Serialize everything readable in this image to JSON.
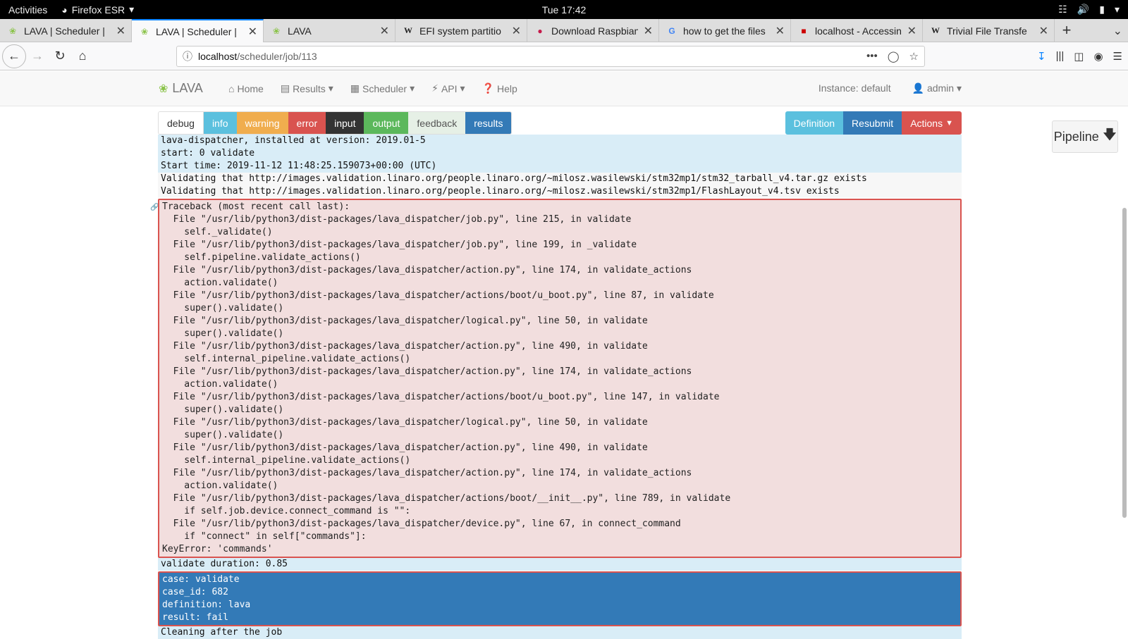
{
  "gnome": {
    "activities": "Activities",
    "app_name": "Firefox ESR",
    "clock": "Tue 17:42"
  },
  "tabs": [
    {
      "title": "LAVA | Scheduler |",
      "icon": "lava-leaf-icon"
    },
    {
      "title": "LAVA | Scheduler |",
      "icon": "lava-leaf-icon"
    },
    {
      "title": "LAVA",
      "icon": "lava-leaf-icon"
    },
    {
      "title": "EFI system partitio",
      "icon": "wikipedia-icon",
      "glyph": "W"
    },
    {
      "title": "Download Raspbian",
      "icon": "raspberry-icon"
    },
    {
      "title": "how to get the files",
      "icon": "google-icon",
      "glyph": "G"
    },
    {
      "title": "localhost - Accessin",
      "icon": "localhost-icon"
    },
    {
      "title": "Trivial File Transfe",
      "icon": "wikipedia-icon",
      "glyph": "W"
    }
  ],
  "url": {
    "host": "localhost",
    "path": "/scheduler/job/113"
  },
  "lava": {
    "brand": "LAVA",
    "menu": {
      "home": "Home",
      "results": "Results",
      "scheduler": "Scheduler",
      "api": "API",
      "help": "Help"
    },
    "instance": "Instance: default",
    "user": "admin"
  },
  "filters": {
    "debug": "debug",
    "info": "info",
    "warning": "warning",
    "error": "error",
    "input": "input",
    "output": "output",
    "feedback": "feedback",
    "results": "results"
  },
  "job_actions": {
    "definition": "Definition",
    "resubmit": "Resubmit",
    "actions": "Actions"
  },
  "pipeline": "Pipeline",
  "log": {
    "pre": [
      {
        "text": "lava-dispatcher, installed at version: 2019.01-5",
        "level": "info"
      },
      {
        "text": "start: 0 validate",
        "level": "info"
      },
      {
        "text": "Start time: 2019-11-12 11:48:25.159073+00:00 (UTC)",
        "level": "info"
      },
      {
        "text": "Validating that http://images.validation.linaro.org/people.linaro.org/~milosz.wasilewski/stm32mp1/stm32_tarball_v4.tar.gz exists",
        "level": "plain"
      },
      {
        "text": "Validating that http://images.validation.linaro.org/people.linaro.org/~milosz.wasilewski/stm32mp1/FlashLayout_v4.tsv exists",
        "level": "plain"
      }
    ],
    "traceback": [
      "Traceback (most recent call last):",
      "  File \"/usr/lib/python3/dist-packages/lava_dispatcher/job.py\", line 215, in validate",
      "    self._validate()",
      "  File \"/usr/lib/python3/dist-packages/lava_dispatcher/job.py\", line 199, in _validate",
      "    self.pipeline.validate_actions()",
      "  File \"/usr/lib/python3/dist-packages/lava_dispatcher/action.py\", line 174, in validate_actions",
      "    action.validate()",
      "  File \"/usr/lib/python3/dist-packages/lava_dispatcher/actions/boot/u_boot.py\", line 87, in validate",
      "    super().validate()",
      "  File \"/usr/lib/python3/dist-packages/lava_dispatcher/logical.py\", line 50, in validate",
      "    super().validate()",
      "  File \"/usr/lib/python3/dist-packages/lava_dispatcher/action.py\", line 490, in validate",
      "    self.internal_pipeline.validate_actions()",
      "  File \"/usr/lib/python3/dist-packages/lava_dispatcher/action.py\", line 174, in validate_actions",
      "    action.validate()",
      "  File \"/usr/lib/python3/dist-packages/lava_dispatcher/actions/boot/u_boot.py\", line 147, in validate",
      "    super().validate()",
      "  File \"/usr/lib/python3/dist-packages/lava_dispatcher/logical.py\", line 50, in validate",
      "    super().validate()",
      "  File \"/usr/lib/python3/dist-packages/lava_dispatcher/action.py\", line 490, in validate",
      "    self.internal_pipeline.validate_actions()",
      "  File \"/usr/lib/python3/dist-packages/lava_dispatcher/action.py\", line 174, in validate_actions",
      "    action.validate()",
      "  File \"/usr/lib/python3/dist-packages/lava_dispatcher/actions/boot/__init__.py\", line 789, in validate",
      "    if self.job.device.connect_command is \"\":",
      "  File \"/usr/lib/python3/dist-packages/lava_dispatcher/device.py\", line 67, in connect_command",
      "    if \"connect\" in self[\"commands\"]:",
      "KeyError: 'commands'"
    ],
    "duration": "validate duration: 0.85",
    "result": [
      "case: validate",
      "case_id: 682",
      "definition: lava",
      "result: fail"
    ],
    "post": "Cleaning after the job"
  }
}
